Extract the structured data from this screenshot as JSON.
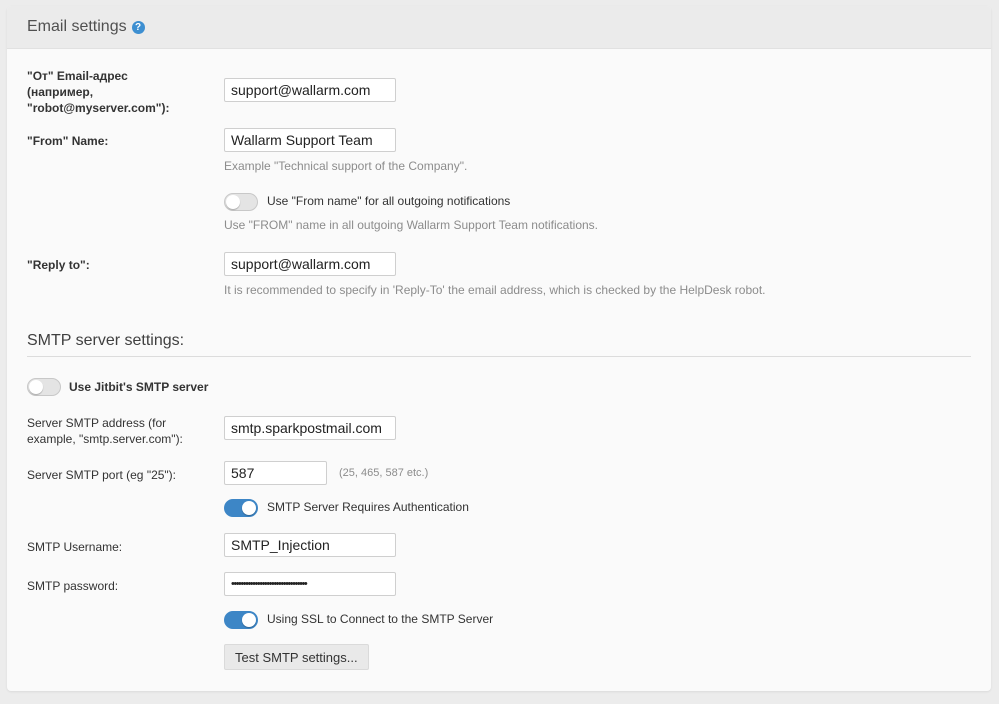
{
  "header": {
    "title": "Email settings",
    "help_icon": "question-circle-icon"
  },
  "email": {
    "from_address_label": "\"От\" Email-адрес (например, \"robot@myserver.com\"):",
    "from_address_value": "support@wallarm.com",
    "from_name_label": "\"From\" Name:",
    "from_name_value": "Wallarm Support Team",
    "from_name_hint": "Example \"Technical support of the Company\".",
    "use_from_name_label": "Use \"From name\" for all outgoing notifications",
    "use_from_name_hint": "Use \"FROM\" name in all outgoing Wallarm Support Team notifications.",
    "reply_to_label": "\"Reply to\":",
    "reply_to_value": "support@wallarm.com",
    "reply_to_hint": "It is recommended to specify in 'Reply-To' the email address, which is checked by the HelpDesk robot."
  },
  "smtp": {
    "section_title": "SMTP server settings:",
    "use_jitbit_label": "Use Jitbit's SMTP server",
    "address_label": "Server SMTP address (for example, \"smtp.server.com\"):",
    "address_value": "smtp.sparkpostmail.com",
    "port_label": "Server SMTP port (eg \"25\"):",
    "port_value": "587",
    "port_hint": "(25, 465, 587 etc.)",
    "auth_label": "SMTP Server Requires Authentication",
    "username_label": "SMTP Username:",
    "username_value": "SMTP_Injection",
    "password_label": "SMTP password:",
    "password_value": "••••••••••••••••••••••••••••••••",
    "ssl_label": "Using SSL to Connect to the SMTP Server",
    "test_button": "Test SMTP settings..."
  },
  "colors": {
    "accent": "#3d86c6",
    "hint": "#8c8c8c"
  }
}
